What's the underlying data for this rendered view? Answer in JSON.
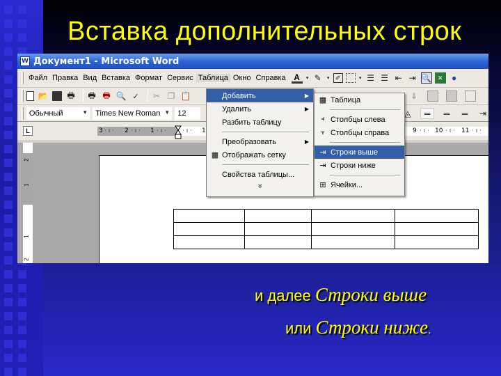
{
  "slide": {
    "title": "Вставка дополнительных строк",
    "caption_line1_prefix": "и далее",
    "caption_line1_emph": "Строки выше",
    "caption_line2_prefix": "или",
    "caption_line2_emph": "Строки ниже",
    "caption_line2_suffix": ".",
    "colors": {
      "title": "#ffff00",
      "caption": "#ffff00",
      "background_top": "#000000",
      "background_bottom": "#2828c8"
    }
  },
  "window": {
    "title": "Документ1 - Microsoft Word",
    "app_icon": "word-icon",
    "titlebar_color": "#2f64d8"
  },
  "menubar": {
    "items": [
      {
        "label": "Файл"
      },
      {
        "label": "Правка"
      },
      {
        "label": "Вид"
      },
      {
        "label": "Вставка"
      },
      {
        "label": "Формат"
      },
      {
        "label": "Сервис"
      },
      {
        "label": "Таблица"
      },
      {
        "label": "Окно"
      },
      {
        "label": "Справка"
      }
    ],
    "extra_icons": [
      "font-color-icon",
      "dropdown-icon",
      "highlight-icon",
      "dropdown-icon",
      "draw-table-icon",
      "borders-icon",
      "dropdown-icon",
      "numbering-icon",
      "bullets-icon",
      "decrease-indent-icon",
      "increase-indent-icon",
      "print-preview-icon",
      "excel-icon",
      "help-icon"
    ]
  },
  "standard_toolbar": {
    "icons": [
      "new-document-icon",
      "open-icon",
      "save-icon",
      "permission-icon",
      "print-icon",
      "print-red-icon",
      "print-preview-icon",
      "spelling-icon",
      "cut-icon",
      "copy-icon",
      "paste-icon"
    ]
  },
  "formatting_toolbar": {
    "style": "Обычный",
    "font": "Times New Roman",
    "size": "12"
  },
  "tables_toolbar": {
    "icons": [
      "insert-rows-icon",
      "insert-columns-icon",
      "shading-icon",
      "shading2-icon",
      "border-icon",
      "align-icon",
      "line-style-icon",
      "line-single-icon",
      "line-double-icon",
      "line-thick-icon",
      "distribute-icon"
    ]
  },
  "ruler": {
    "horizontal_labels": [
      "3",
      "2",
      "1",
      "1",
      "9",
      "10",
      "11"
    ],
    "vertical_labels": [
      "2",
      "1",
      "1",
      "2"
    ]
  },
  "table_menu": {
    "items": [
      {
        "label": "Добавить",
        "has_submenu": true,
        "highlighted": true
      },
      {
        "label": "Удалить",
        "has_submenu": true
      },
      {
        "label": "Разбить таблицу"
      },
      {
        "separator": true
      },
      {
        "label": "Преобразовать",
        "has_submenu": true
      },
      {
        "label": "Отображать сетку",
        "icon": "grid-icon"
      },
      {
        "separator": true
      },
      {
        "label": "Свойства таблицы..."
      }
    ],
    "expand_glyph": "»"
  },
  "insert_submenu": {
    "items": [
      {
        "label": "Таблица",
        "icon": "table-icon"
      },
      {
        "separator": true
      },
      {
        "label": "Столбцы слева",
        "icon": "columns-left-icon"
      },
      {
        "label": "Столбцы справа",
        "icon": "columns-right-icon"
      },
      {
        "separator": true
      },
      {
        "label": "Строки выше",
        "icon": "rows-above-icon",
        "highlighted": true
      },
      {
        "label": "Строки ниже",
        "icon": "rows-below-icon"
      },
      {
        "separator": true
      },
      {
        "label": "Ячейки...",
        "icon": "cells-icon"
      }
    ],
    "highlight_color": "#335ea8"
  },
  "document": {
    "table": {
      "rows": 3,
      "columns": 4,
      "cells": [
        [
          "",
          "",
          "",
          ""
        ],
        [
          "",
          "",
          "",
          ""
        ],
        [
          "",
          "",
          "",
          ""
        ]
      ]
    }
  }
}
